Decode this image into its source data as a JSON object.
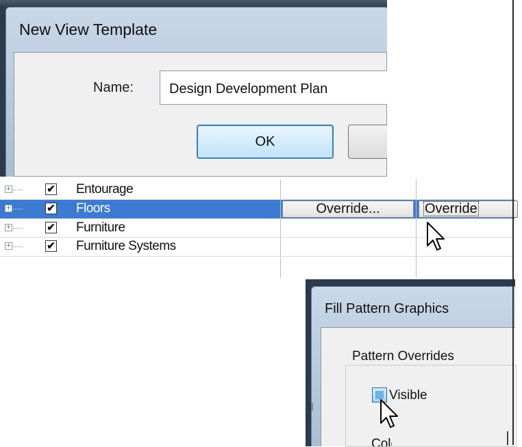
{
  "new_view_template": {
    "title": "New View Template",
    "name_label": "Name:",
    "name_value": "Design Development Plan",
    "ok_label": "OK"
  },
  "categories": {
    "rows": [
      {
        "label": "Entourage",
        "checked": true,
        "selected": false
      },
      {
        "label": "Floors",
        "checked": true,
        "selected": true
      },
      {
        "label": "Furniture",
        "checked": true,
        "selected": false
      },
      {
        "label": "Furniture Systems",
        "checked": true,
        "selected": false
      }
    ],
    "override_label_1": "Override...",
    "override_label_2": "Override"
  },
  "fill_pattern_graphics": {
    "title": "Fill Pattern Graphics",
    "group_label": "Pattern Overrides",
    "visible_label": "Visible",
    "next_label": "Color:"
  },
  "icons": {
    "expander": "plus-box-icon",
    "check": "✔",
    "cursor": "mouse-pointer-icon"
  }
}
